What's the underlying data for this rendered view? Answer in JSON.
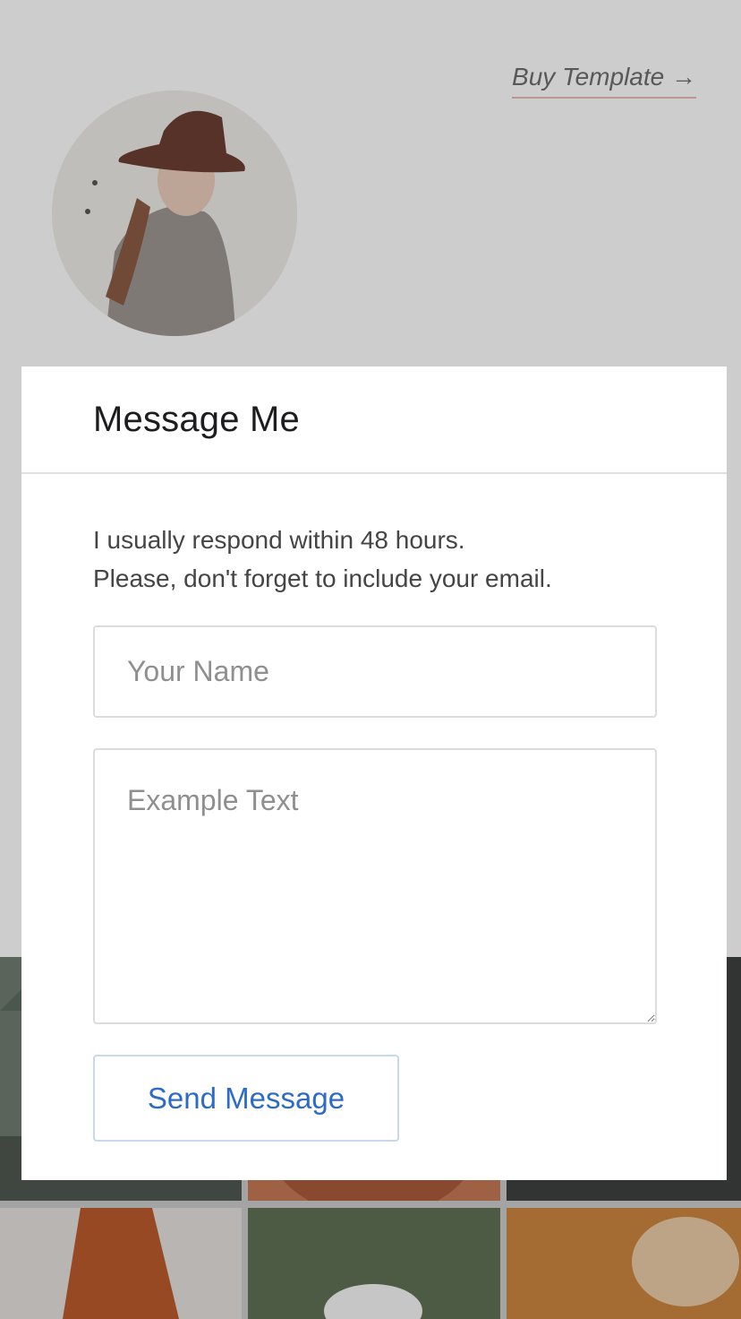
{
  "header": {
    "buy_link": "Buy Template →"
  },
  "modal": {
    "title": "Message Me",
    "intro_line1": "I usually respond within 48 hours.",
    "intro_line2": "Please, don't forget to include your email.",
    "name_placeholder": "Your Name",
    "message_placeholder": "Example Text",
    "send_label": "Send Message"
  },
  "colors": {
    "accent_button_text": "#2d6bc4",
    "link_underline": "#e4b8b4",
    "overlay": "rgba(0,0,0,0.18)"
  }
}
